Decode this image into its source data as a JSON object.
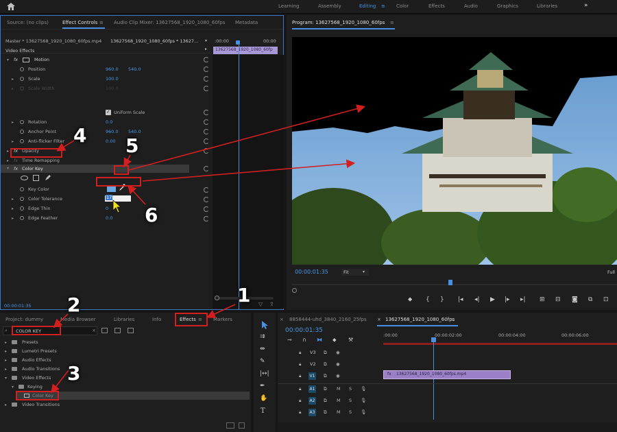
{
  "workspaces": [
    "Learning",
    "Assembly",
    "Editing",
    "Color",
    "Effects",
    "Audio",
    "Graphics",
    "Libraries"
  ],
  "active_workspace": "Editing",
  "more_glyph": "»",
  "source_tabs": {
    "source": "Source: (no clips)",
    "effect_controls": "Effect Controls",
    "audio_mixer": "Audio Clip Mixer: 13627568_1920_1080_60fps",
    "metadata": "Metadata"
  },
  "effect_controls": {
    "master": "Master * 13627568_1920_1080_60fps.mp4",
    "clip": "13627568_1920_1080_60fps * 13627...",
    "timeline_start": ":00:00",
    "timeline_end": "00:00",
    "clip_bar": "13627568_1920_1080_60fp",
    "section": "Video Effects",
    "motion": "Motion",
    "position_label": "Position",
    "position_x": "960.0",
    "position_y": "540.0",
    "scale_label": "Scale",
    "scale_value": "100.0",
    "scale_width_label": "Scale Width",
    "scale_width_value": "100.0",
    "uniform_scale": "Uniform Scale",
    "rotation_label": "Rotation",
    "rotation_value": "0.0",
    "anchor_label": "Anchor Point",
    "anchor_x": "960.0",
    "anchor_y": "540.0",
    "antiflicker_label": "Anti-flicker Filter",
    "antiflicker_value": "0.00",
    "opacity": "Opacity",
    "time_remap": "Time Remapping",
    "color_key": "Color Key",
    "key_color_label": "Key Color",
    "tolerance_label": "Color Tolerance",
    "tolerance_value": "17",
    "edge_thin_label": "Edge Thin",
    "edge_thin_value": "0",
    "edge_feather_label": "Edge Feather",
    "edge_feather_value": "0.0",
    "timecode": "00:00:01:35",
    "fx": "fx"
  },
  "program": {
    "title": "Program: 13627568_1920_1080_60fps",
    "timecode": "00:00:01:35",
    "fit": "Fit",
    "full": "Full"
  },
  "project_tabs": {
    "project": "Project: dummy",
    "media_browser": "Media Browser",
    "libraries": "Libraries",
    "info": "Info",
    "effects": "Effects",
    "markers": "Markers"
  },
  "effects_search": "COLOR KEY",
  "effects_tree": {
    "presets": "Presets",
    "lumetri": "Lumetri Presets",
    "audio_effects": "Audio Effects",
    "audio_transitions": "Audio Transitions",
    "video_effects": "Video Effects",
    "keying": "Keying",
    "color_key": "Color Key",
    "video_transitions": "Video Transitions"
  },
  "timeline": {
    "tab1": "8858444-uhd_3840_2160_25fps",
    "tab2": "13627568_1920_1080_60fps",
    "timecode": "00:00:01:35",
    "ruler": [
      ":00:00",
      "00:00:02:00",
      "00:00:04:00",
      "00:00:06:00"
    ],
    "tracks": [
      "V3",
      "V2",
      "V1",
      "A1",
      "A2",
      "A3"
    ],
    "clip": "13627568_1920_1080_60fps.mp4",
    "m": "M",
    "s": "S"
  },
  "annotations": [
    "1",
    "2",
    "3",
    "4",
    "5",
    "6"
  ],
  "colors": {
    "accent": "#4a90e2",
    "annotation": "#d41f1f",
    "clip": "#9b7fc7"
  }
}
